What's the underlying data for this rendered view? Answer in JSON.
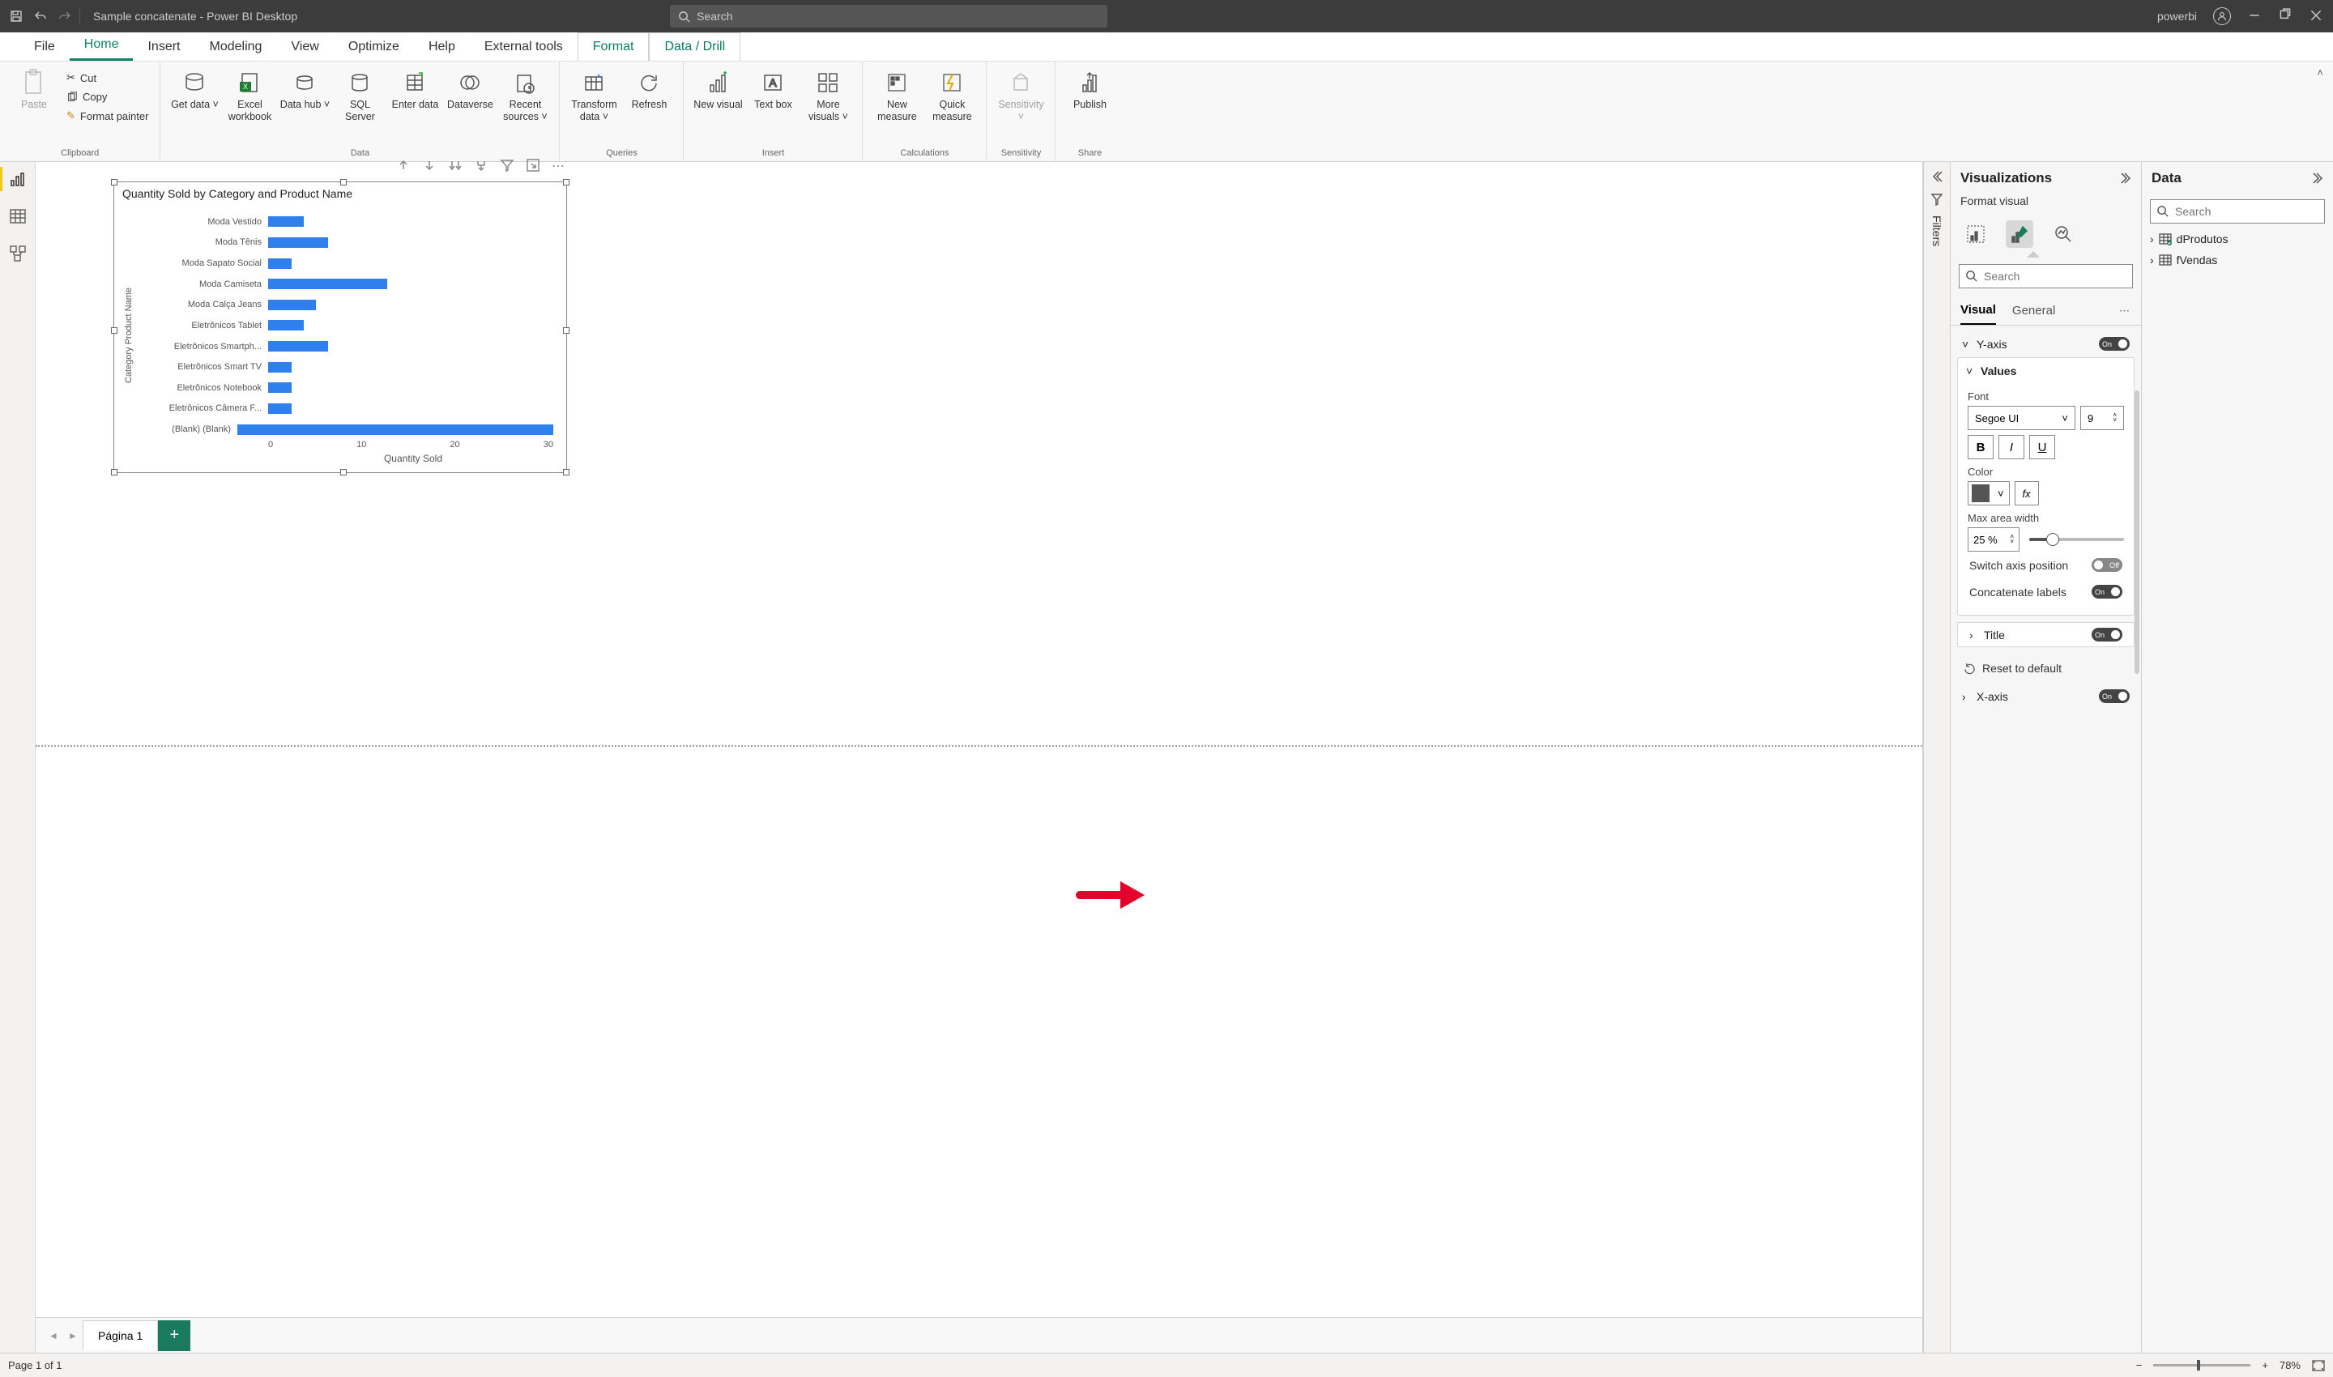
{
  "titlebar": {
    "title": "Sample concatenate - Power BI Desktop",
    "search_placeholder": "Search",
    "user": "powerbi"
  },
  "ribbon": {
    "tabs": [
      "File",
      "Home",
      "Insert",
      "Modeling",
      "View",
      "Optimize",
      "Help",
      "External tools",
      "Format",
      "Data / Drill"
    ],
    "active_tab": "Home",
    "groups": {
      "clipboard": {
        "label": "Clipboard",
        "paste": "Paste",
        "cut": "Cut",
        "copy": "Copy",
        "format_painter": "Format painter"
      },
      "data": {
        "label": "Data",
        "get_data": "Get data",
        "excel": "Excel workbook",
        "data_hub": "Data hub",
        "sql": "SQL Server",
        "enter": "Enter data",
        "dataverse": "Dataverse",
        "recent": "Recent sources"
      },
      "queries": {
        "label": "Queries",
        "transform": "Transform data",
        "refresh": "Refresh"
      },
      "insert": {
        "label": "Insert",
        "new_visual": "New visual",
        "text_box": "Text box",
        "more": "More visuals"
      },
      "calculations": {
        "label": "Calculations",
        "new_measure": "New measure",
        "quick_measure": "Quick measure"
      },
      "sensitivity": {
        "label": "Sensitivity",
        "btn": "Sensitivity"
      },
      "share": {
        "label": "Share",
        "publish": "Publish"
      }
    }
  },
  "chart_data": {
    "type": "bar",
    "title": "Quantity Sold by Category and Product Name",
    "ylabel": "Category Product Name",
    "xlabel": "Quantity Sold",
    "xlim": [
      0,
      35
    ],
    "categories": [
      "Moda Vestido",
      "Moda Tênis",
      "Moda Sapato Social",
      "Moda Camiseta",
      "Moda Calça Jeans",
      "Eletrônicos Tablet",
      "Eletrônicos Smartph...",
      "Eletrônicos Smart TV",
      "Eletrônicos Notebook",
      "Eletrônicos Câmera F...",
      "(Blank) (Blank)"
    ],
    "values": [
      3,
      5,
      2,
      10,
      4,
      3,
      5,
      2,
      2,
      2,
      35
    ],
    "xticks": [
      "0",
      "10",
      "20",
      "30"
    ]
  },
  "page_tabs": {
    "current": "Página 1"
  },
  "filters_label": "Filters",
  "viz_pane": {
    "title": "Visualizations",
    "subtitle": "Format visual",
    "search_placeholder": "Search",
    "tabs": {
      "visual": "Visual",
      "general": "General"
    },
    "sections": {
      "yaxis": {
        "label": "Y-axis",
        "state": "On"
      },
      "values": {
        "label": "Values",
        "font_label": "Font",
        "font_family": "Segoe UI",
        "font_size": "9",
        "color_label": "Color",
        "max_area_label": "Max area width",
        "max_area_value": "25 %",
        "switch_axis": "Switch axis position",
        "switch_axis_state": "Off",
        "concat": "Concatenate labels",
        "concat_state": "On"
      },
      "title": {
        "label": "Title",
        "state": "On"
      },
      "reset": "Reset to default",
      "xaxis": {
        "label": "X-axis",
        "state": "On"
      }
    }
  },
  "data_pane": {
    "title": "Data",
    "search_placeholder": "Search",
    "tables": [
      "dProdutos",
      "fVendas"
    ]
  },
  "statusbar": {
    "page": "Page 1 of 1",
    "zoom": "78%"
  }
}
